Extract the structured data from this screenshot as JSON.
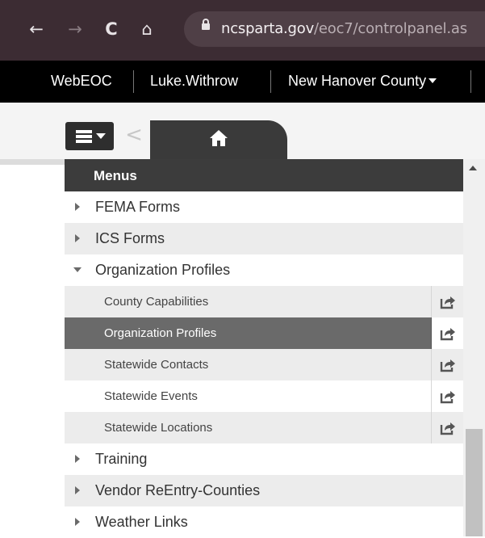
{
  "browser": {
    "back_icon": "←",
    "forward_icon": "→",
    "reload_icon": "C",
    "home_icon": "⌂",
    "url_host": "ncsparta.gov",
    "url_path": "/eoc7/controlpanel.as"
  },
  "topbar": {
    "app": "WebEOC",
    "user": "Luke.Withrow",
    "position": "New Hanover County"
  },
  "toolbar": {
    "back_icon": "<"
  },
  "menu": {
    "title": "Menus",
    "items": [
      {
        "label": "FEMA Forms"
      },
      {
        "label": "ICS Forms"
      },
      {
        "label": "Organization Profiles"
      },
      {
        "label": "Training"
      },
      {
        "label": "Vendor ReEntry-Counties"
      },
      {
        "label": "Weather Links"
      }
    ],
    "subitems": [
      {
        "label": "County Capabilities"
      },
      {
        "label": "Organization Profiles"
      },
      {
        "label": "Statewide Contacts"
      },
      {
        "label": "Statewide Events"
      },
      {
        "label": "Statewide Locations"
      }
    ]
  },
  "colors": {
    "browser_bg": "#3c2c33",
    "topbar_bg": "#000000",
    "menu_header_bg": "#3c3c3c",
    "active_row_bg": "#6a6a6a"
  }
}
